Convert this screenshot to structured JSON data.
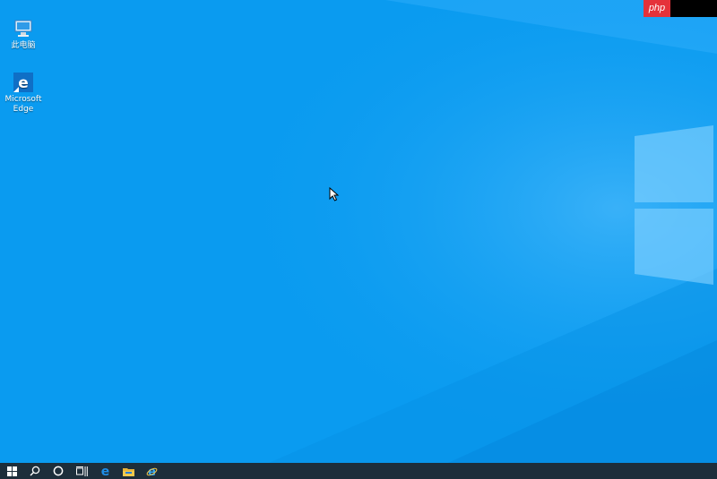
{
  "desktop": {
    "icons": [
      {
        "label": "此电脑",
        "icon": "this-pc-icon"
      },
      {
        "label": "Microsoft\nEdge",
        "icon": "edge-icon"
      }
    ]
  },
  "watermark": {
    "text": "php"
  },
  "taskbar": {
    "buttons": [
      {
        "icon": "windows-start-icon"
      },
      {
        "icon": "search-icon"
      },
      {
        "icon": "cortana-icon"
      },
      {
        "icon": "task-view-icon"
      },
      {
        "icon": "edge-icon"
      },
      {
        "icon": "file-explorer-icon"
      },
      {
        "icon": "internet-explorer-icon"
      }
    ]
  },
  "colors": {
    "wallpaper": "#0a9bf0",
    "taskbar": "#1d2e3b",
    "accent": "#0078d7"
  }
}
